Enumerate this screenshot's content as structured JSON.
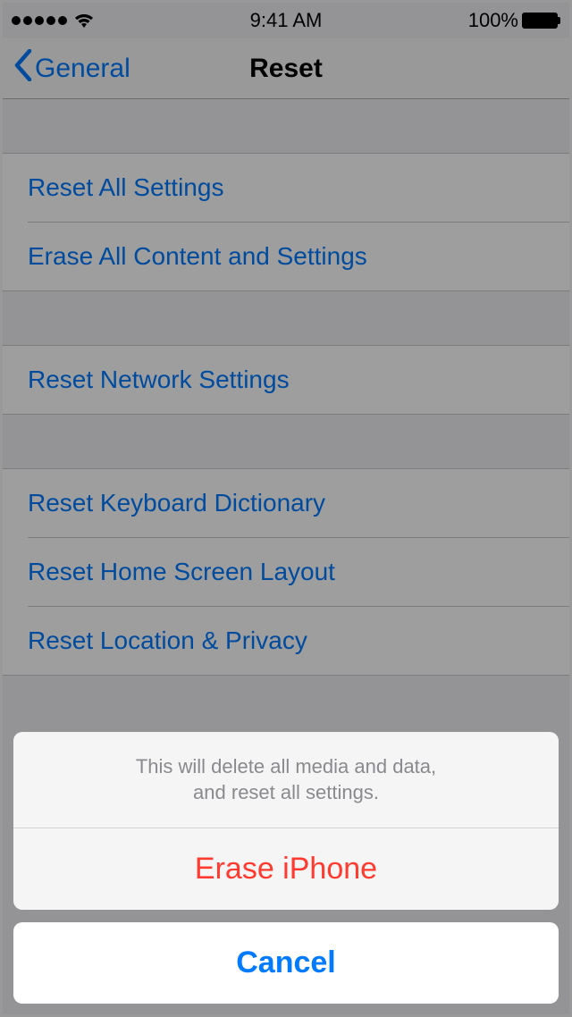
{
  "status_bar": {
    "time": "9:41 AM",
    "battery_percent": "100%"
  },
  "nav": {
    "back_label": "General",
    "title": "Reset"
  },
  "groups": {
    "g1": {
      "reset_all_settings": "Reset All Settings",
      "erase_all": "Erase All Content and Settings"
    },
    "g2": {
      "reset_network": "Reset Network Settings"
    },
    "g3": {
      "reset_keyboard": "Reset Keyboard Dictionary",
      "reset_home": "Reset Home Screen Layout",
      "reset_location": "Reset Location & Privacy"
    }
  },
  "action_sheet": {
    "message_line1": "This will delete all media and data,",
    "message_line2": "and reset all settings.",
    "destructive_label": "Erase iPhone",
    "cancel_label": "Cancel"
  }
}
